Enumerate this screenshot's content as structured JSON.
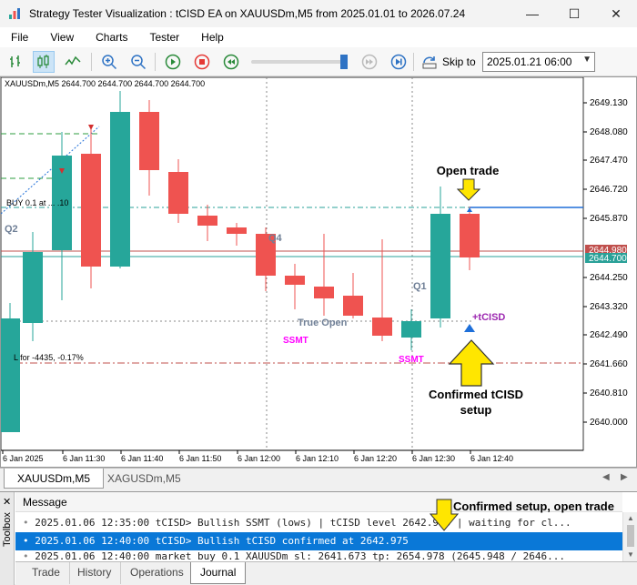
{
  "window": {
    "title": "Strategy Tester Visualization : tCISD EA on XAUUSDm,M5 from 2025.01.01 to 2026.07.24",
    "minimize": "—",
    "maximize": "☐",
    "close": "✕"
  },
  "menu": [
    "File",
    "View",
    "Charts",
    "Tester",
    "Help"
  ],
  "toolbar": {
    "skip_label": "Skip to",
    "skip_date": "2025.01.21 06:00",
    "speed_fraction": 0.96
  },
  "chart": {
    "info_line": "XAUUSDm,M5  2644.700 2644.700 2644.700 2644.700",
    "buy_label": "BUY 0.1 at ... .10",
    "sl_label": "L for -4435, -0.17%",
    "price_ticks": [
      "2649.130",
      "2648.080",
      "2647.470",
      "2646.720",
      "2645.870",
      "2644.980",
      "2644.700",
      "2644.250",
      "2643.320",
      "2642.490",
      "2641.660",
      "2640.810",
      "2640.000"
    ],
    "bid_tag": "2644.980",
    "ask_tag": "2644.700",
    "time_ticks": [
      "6 Jan 2025",
      "6 Jan 11:30",
      "6 Jan 11:40",
      "6 Jan 11:50",
      "6 Jan 12:00",
      "6 Jan 12:10",
      "6 Jan 12:20",
      "6 Jan 12:30",
      "6 Jan 12:40"
    ],
    "labels": {
      "q2": "Q2",
      "q4": "Q4",
      "q1": "Q1",
      "true_open": "True Open",
      "ssmt1": "SSMT",
      "ssmt2": "SSMT",
      "tcisd": "+tCISD"
    },
    "colors": {
      "bull": "#26a69a",
      "bear": "#ef5350",
      "ssmt": "#ff00ff",
      "tcisd": "#9c27b0",
      "arrow": "#ffe600"
    }
  },
  "annotations": {
    "open_trade": "Open trade",
    "confirmed_line1": "Confirmed tCISD",
    "confirmed_line2": "setup",
    "confirmed_open": "Confirmed setup, open trade"
  },
  "symbol_tabs": [
    "XAUUSDm,M5",
    "XAGUSDm,M5"
  ],
  "toolbox": {
    "side_label": "Toolbox",
    "header": "Message",
    "rows": [
      "2025.01.06 12:35:00   tCISD> Bullish SSMT (lows) | tCISD level 2642.975 | waiting for cl...",
      "2025.01.06 12:40:00   tCISD> Bullish tCISD confirmed at 2642.975",
      "2025.01.06 12:40:00   market buy 0.1 XAUUSDm sl: 2641.673 tp: 2654.978 (2645.948 / 2646..."
    ],
    "tabs": [
      "Trade",
      "History",
      "Operations",
      "Journal"
    ]
  }
}
